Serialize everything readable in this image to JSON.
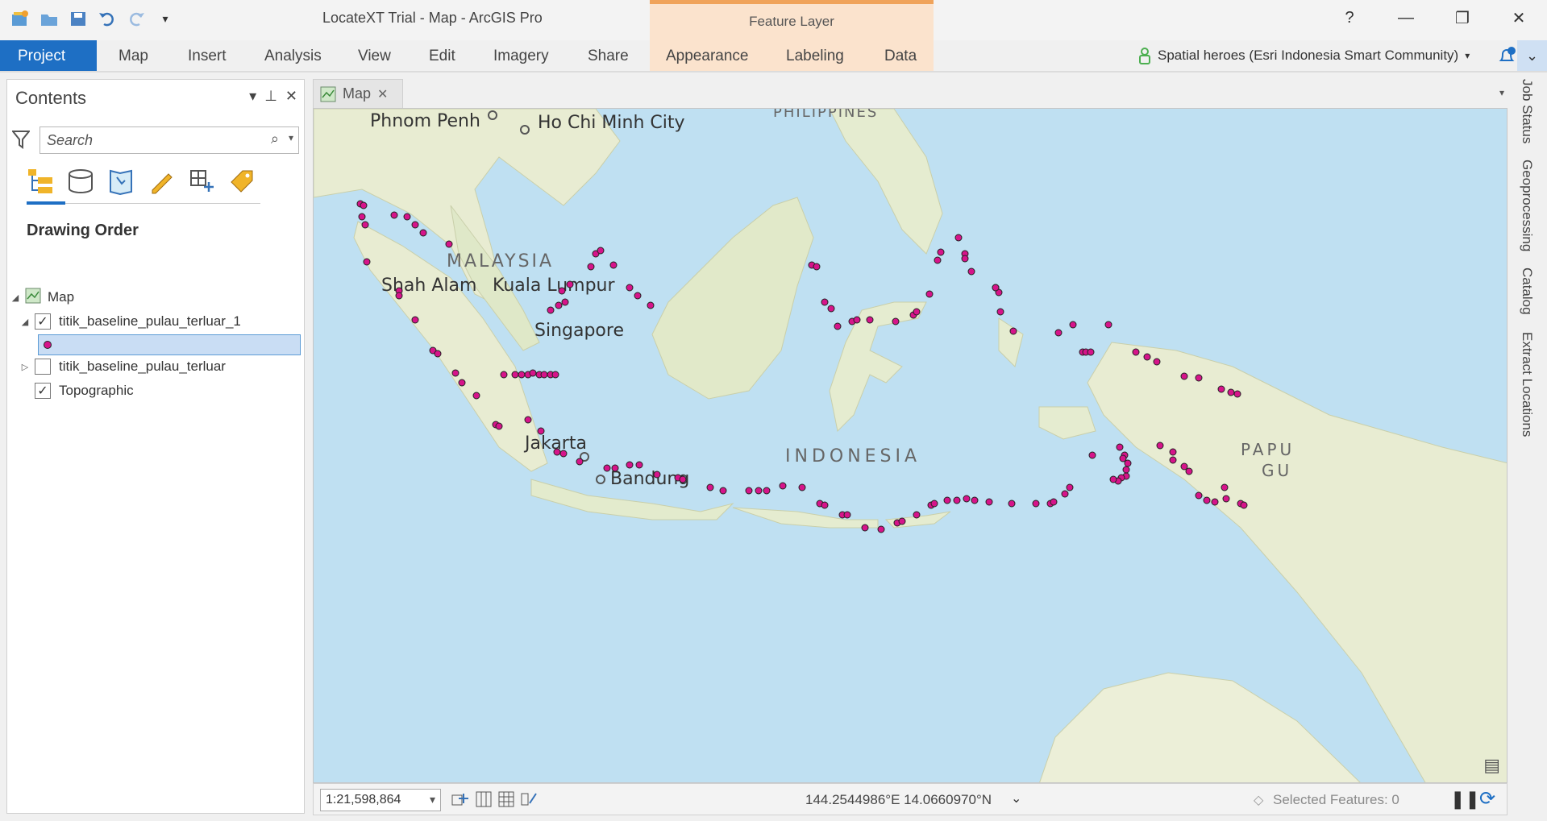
{
  "window": {
    "title": "LocateXT Trial - Map - ArcGIS Pro",
    "context_tab_group": "Feature Layer",
    "controls": {
      "help": "?",
      "minimize": "—",
      "restore": "❐",
      "close": "✕"
    }
  },
  "ribbon": {
    "tabs": [
      "Project",
      "Map",
      "Insert",
      "Analysis",
      "View",
      "Edit",
      "Imagery",
      "Share",
      "Appearance",
      "Labeling",
      "Data"
    ],
    "active_tab": "Project",
    "user": "Spatial heroes (Esri Indonesia Smart Community)"
  },
  "contents": {
    "title": "Contents",
    "search_placeholder": "Search",
    "drawing_order_label": "Drawing Order",
    "tree": {
      "map": "Map",
      "layer1": "titik_baseline_pulau_terluar_1",
      "layer2": "titik_baseline_pulau_terluar",
      "basemap": "Topographic"
    },
    "checked": {
      "layer1": true,
      "layer2": false,
      "basemap": true
    }
  },
  "map_tab": {
    "label": "Map"
  },
  "map": {
    "labels": {
      "phnom_penh": "Phnom Penh",
      "hcmc": "Ho Chi Minh City",
      "philippines": "PHILIPPINES",
      "malaysia": "MALAYSIA",
      "shah_alam": "Shah Alam",
      "kuala_lumpur": "Kuala Lumpur",
      "singapore": "Singapore",
      "jakarta": "Jakarta",
      "bandung": "Bandung",
      "indonesia": "INDONESIA",
      "papua": "PAPU",
      "papua2": "GU"
    },
    "point_color": "#d6148a"
  },
  "status": {
    "scale": "1:21,598,864",
    "coordinates": "144.2544986°E 14.0660970°N",
    "selected_features": "Selected Features: 0"
  },
  "right_dock": [
    "Job Status",
    "Geoprocessing",
    "Catalog",
    "Extract Locations"
  ],
  "colors": {
    "accent": "#1e6fc4",
    "context_tab": "#fbe3cd",
    "context_tab_border": "#f0a35a",
    "water": "#bfe0f2",
    "land": "#eef0dc"
  }
}
